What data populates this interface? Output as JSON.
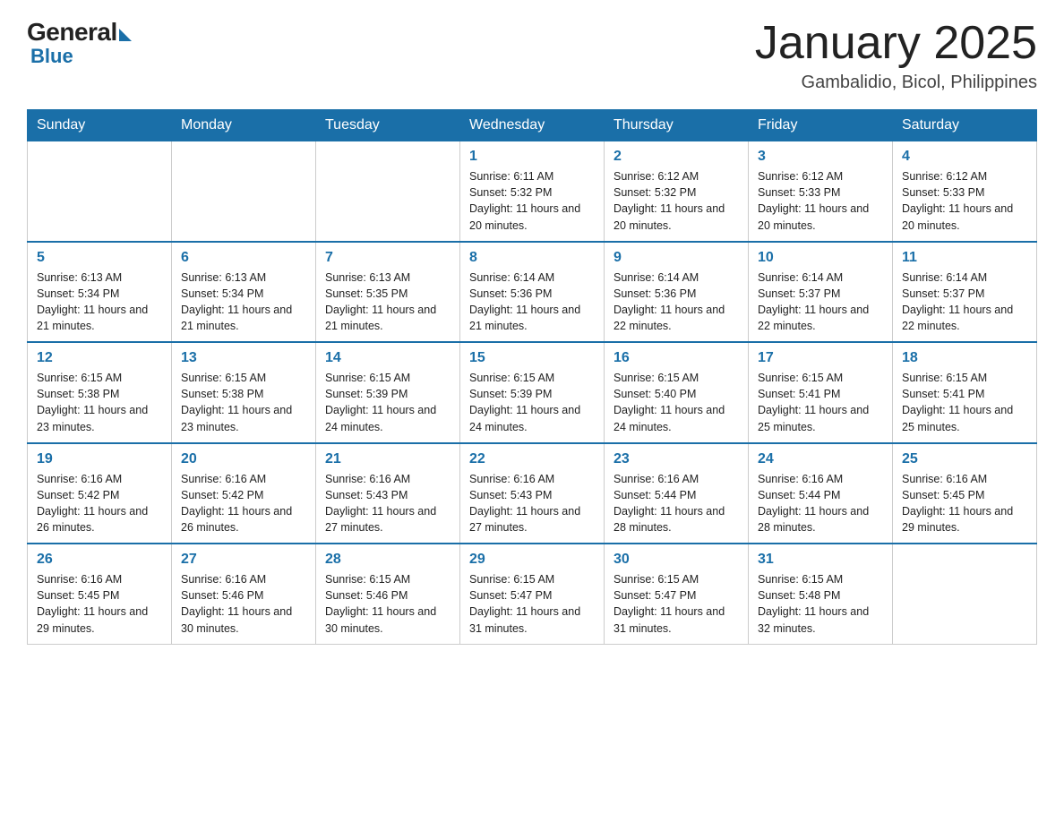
{
  "logo": {
    "general": "General",
    "blue": "Blue"
  },
  "title": "January 2025",
  "location": "Gambalidio, Bicol, Philippines",
  "days_of_week": [
    "Sunday",
    "Monday",
    "Tuesday",
    "Wednesday",
    "Thursday",
    "Friday",
    "Saturday"
  ],
  "weeks": [
    [
      {
        "day": "",
        "info": ""
      },
      {
        "day": "",
        "info": ""
      },
      {
        "day": "",
        "info": ""
      },
      {
        "day": "1",
        "info": "Sunrise: 6:11 AM\nSunset: 5:32 PM\nDaylight: 11 hours and 20 minutes."
      },
      {
        "day": "2",
        "info": "Sunrise: 6:12 AM\nSunset: 5:32 PM\nDaylight: 11 hours and 20 minutes."
      },
      {
        "day": "3",
        "info": "Sunrise: 6:12 AM\nSunset: 5:33 PM\nDaylight: 11 hours and 20 minutes."
      },
      {
        "day": "4",
        "info": "Sunrise: 6:12 AM\nSunset: 5:33 PM\nDaylight: 11 hours and 20 minutes."
      }
    ],
    [
      {
        "day": "5",
        "info": "Sunrise: 6:13 AM\nSunset: 5:34 PM\nDaylight: 11 hours and 21 minutes."
      },
      {
        "day": "6",
        "info": "Sunrise: 6:13 AM\nSunset: 5:34 PM\nDaylight: 11 hours and 21 minutes."
      },
      {
        "day": "7",
        "info": "Sunrise: 6:13 AM\nSunset: 5:35 PM\nDaylight: 11 hours and 21 minutes."
      },
      {
        "day": "8",
        "info": "Sunrise: 6:14 AM\nSunset: 5:36 PM\nDaylight: 11 hours and 21 minutes."
      },
      {
        "day": "9",
        "info": "Sunrise: 6:14 AM\nSunset: 5:36 PM\nDaylight: 11 hours and 22 minutes."
      },
      {
        "day": "10",
        "info": "Sunrise: 6:14 AM\nSunset: 5:37 PM\nDaylight: 11 hours and 22 minutes."
      },
      {
        "day": "11",
        "info": "Sunrise: 6:14 AM\nSunset: 5:37 PM\nDaylight: 11 hours and 22 minutes."
      }
    ],
    [
      {
        "day": "12",
        "info": "Sunrise: 6:15 AM\nSunset: 5:38 PM\nDaylight: 11 hours and 23 minutes."
      },
      {
        "day": "13",
        "info": "Sunrise: 6:15 AM\nSunset: 5:38 PM\nDaylight: 11 hours and 23 minutes."
      },
      {
        "day": "14",
        "info": "Sunrise: 6:15 AM\nSunset: 5:39 PM\nDaylight: 11 hours and 24 minutes."
      },
      {
        "day": "15",
        "info": "Sunrise: 6:15 AM\nSunset: 5:39 PM\nDaylight: 11 hours and 24 minutes."
      },
      {
        "day": "16",
        "info": "Sunrise: 6:15 AM\nSunset: 5:40 PM\nDaylight: 11 hours and 24 minutes."
      },
      {
        "day": "17",
        "info": "Sunrise: 6:15 AM\nSunset: 5:41 PM\nDaylight: 11 hours and 25 minutes."
      },
      {
        "day": "18",
        "info": "Sunrise: 6:15 AM\nSunset: 5:41 PM\nDaylight: 11 hours and 25 minutes."
      }
    ],
    [
      {
        "day": "19",
        "info": "Sunrise: 6:16 AM\nSunset: 5:42 PM\nDaylight: 11 hours and 26 minutes."
      },
      {
        "day": "20",
        "info": "Sunrise: 6:16 AM\nSunset: 5:42 PM\nDaylight: 11 hours and 26 minutes."
      },
      {
        "day": "21",
        "info": "Sunrise: 6:16 AM\nSunset: 5:43 PM\nDaylight: 11 hours and 27 minutes."
      },
      {
        "day": "22",
        "info": "Sunrise: 6:16 AM\nSunset: 5:43 PM\nDaylight: 11 hours and 27 minutes."
      },
      {
        "day": "23",
        "info": "Sunrise: 6:16 AM\nSunset: 5:44 PM\nDaylight: 11 hours and 28 minutes."
      },
      {
        "day": "24",
        "info": "Sunrise: 6:16 AM\nSunset: 5:44 PM\nDaylight: 11 hours and 28 minutes."
      },
      {
        "day": "25",
        "info": "Sunrise: 6:16 AM\nSunset: 5:45 PM\nDaylight: 11 hours and 29 minutes."
      }
    ],
    [
      {
        "day": "26",
        "info": "Sunrise: 6:16 AM\nSunset: 5:45 PM\nDaylight: 11 hours and 29 minutes."
      },
      {
        "day": "27",
        "info": "Sunrise: 6:16 AM\nSunset: 5:46 PM\nDaylight: 11 hours and 30 minutes."
      },
      {
        "day": "28",
        "info": "Sunrise: 6:15 AM\nSunset: 5:46 PM\nDaylight: 11 hours and 30 minutes."
      },
      {
        "day": "29",
        "info": "Sunrise: 6:15 AM\nSunset: 5:47 PM\nDaylight: 11 hours and 31 minutes."
      },
      {
        "day": "30",
        "info": "Sunrise: 6:15 AM\nSunset: 5:47 PM\nDaylight: 11 hours and 31 minutes."
      },
      {
        "day": "31",
        "info": "Sunrise: 6:15 AM\nSunset: 5:48 PM\nDaylight: 11 hours and 32 minutes."
      },
      {
        "day": "",
        "info": ""
      }
    ]
  ]
}
